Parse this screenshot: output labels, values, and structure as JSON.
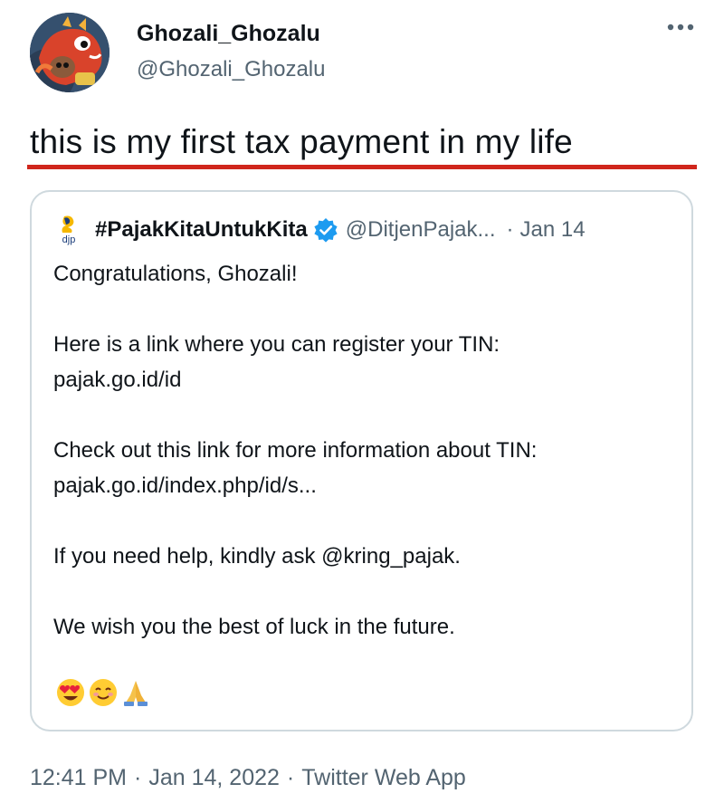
{
  "author": {
    "display_name": "Ghozali_Ghozalu",
    "handle": "@Ghozali_Ghozalu",
    "avatar_icon": "character-avatar"
  },
  "tweet": {
    "text": "this is my first tax payment in my life",
    "underline_color": "#d0261c"
  },
  "menu": {
    "icon": "more-horizontal-icon"
  },
  "quote": {
    "logo_icon": "djp-logo-icon",
    "name": "#PajakKitaUntukKita",
    "verified_icon": "verified-badge-icon",
    "handle": "@DitjenPajak...",
    "dot": "·",
    "date": "Jan 14",
    "lines": [
      "Congratulations, Ghozali!",
      "Here is a link where you can register your TIN:",
      "pajak.go.id/id",
      "Check out this link for more information about TIN:",
      "pajak.go.id/index.php/id/s...",
      "If you need help, kindly ask @kring_pajak.",
      "We wish you the best of luck in the future."
    ],
    "emojis": [
      "heart-eyes-emoji",
      "smiling-face-emoji",
      "folded-hands-emoji"
    ]
  },
  "meta": {
    "time": "12:41 PM",
    "sep1": "·",
    "date": "Jan 14, 2022",
    "sep2": "·",
    "source": "Twitter Web App"
  },
  "colors": {
    "text": "#0f1419",
    "secondary": "#536471",
    "border": "#cfd9de",
    "verified": "#1d9bf0",
    "accent_red": "#d0261c"
  }
}
